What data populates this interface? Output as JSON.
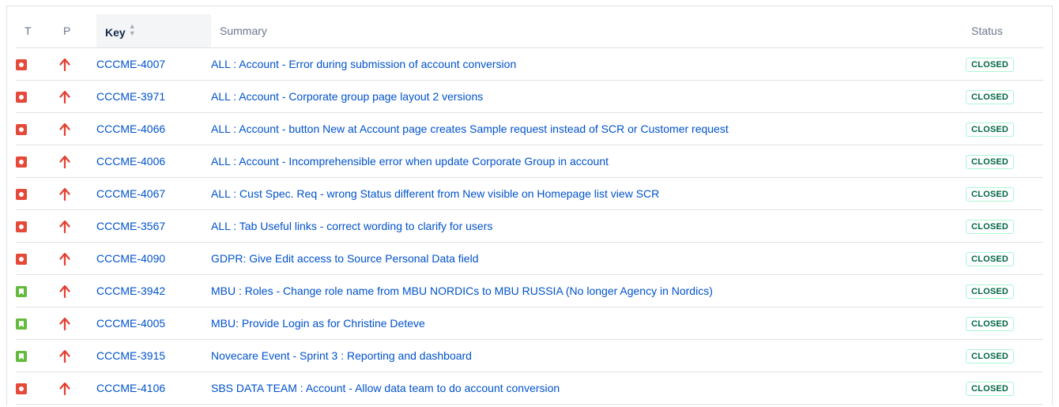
{
  "columns": {
    "type": "T",
    "priority": "P",
    "key": "Key",
    "summary": "Summary",
    "status": "Status"
  },
  "colors": {
    "link": "#0052cc",
    "bug": "#e5493a",
    "story": "#63ba3c",
    "priority_high": "#e53e30",
    "status_closed_text": "#006644",
    "status_closed_border": "#abf5d1"
  },
  "issues": [
    {
      "type": "bug",
      "priority": "high",
      "key": "CCCME-4007",
      "summary": "ALL : Account - Error during submission of account conversion",
      "status": "CLOSED"
    },
    {
      "type": "bug",
      "priority": "high",
      "key": "CCCME-3971",
      "summary": "ALL : Account - Corporate group page layout 2 versions",
      "status": "CLOSED"
    },
    {
      "type": "bug",
      "priority": "high",
      "key": "CCCME-4066",
      "summary": "ALL : Account - button New at Account page creates Sample request instead of SCR or Customer request",
      "status": "CLOSED"
    },
    {
      "type": "bug",
      "priority": "high",
      "key": "CCCME-4006",
      "summary": "ALL : Account - Incomprehensible error when update Corporate Group in account",
      "status": "CLOSED"
    },
    {
      "type": "bug",
      "priority": "high",
      "key": "CCCME-4067",
      "summary": "ALL : Cust Spec. Req - wrong Status different from New visible on Homepage list view SCR",
      "status": "CLOSED"
    },
    {
      "type": "bug",
      "priority": "high",
      "key": "CCCME-3567",
      "summary": "ALL : Tab Useful links - correct wording to clarify for users",
      "status": "CLOSED"
    },
    {
      "type": "bug",
      "priority": "high",
      "key": "CCCME-4090",
      "summary": "GDPR: Give Edit access to Source Personal Data field",
      "status": "CLOSED"
    },
    {
      "type": "story",
      "priority": "high",
      "key": "CCCME-3942",
      "summary": "MBU : Roles - Change role name from MBU NORDICs to MBU RUSSIA (No longer Agency in Nordics)",
      "status": "CLOSED"
    },
    {
      "type": "story",
      "priority": "high",
      "key": "CCCME-4005",
      "summary": "MBU: Provide Login as for Christine Deteve",
      "status": "CLOSED"
    },
    {
      "type": "story",
      "priority": "high",
      "key": "CCCME-3915",
      "summary": "Novecare Event - Sprint 3 : Reporting and dashboard",
      "status": "CLOSED"
    },
    {
      "type": "bug",
      "priority": "high",
      "key": "CCCME-4106",
      "summary": "SBS DATA TEAM : Account - Allow data team to do account conversion",
      "status": "CLOSED"
    }
  ]
}
